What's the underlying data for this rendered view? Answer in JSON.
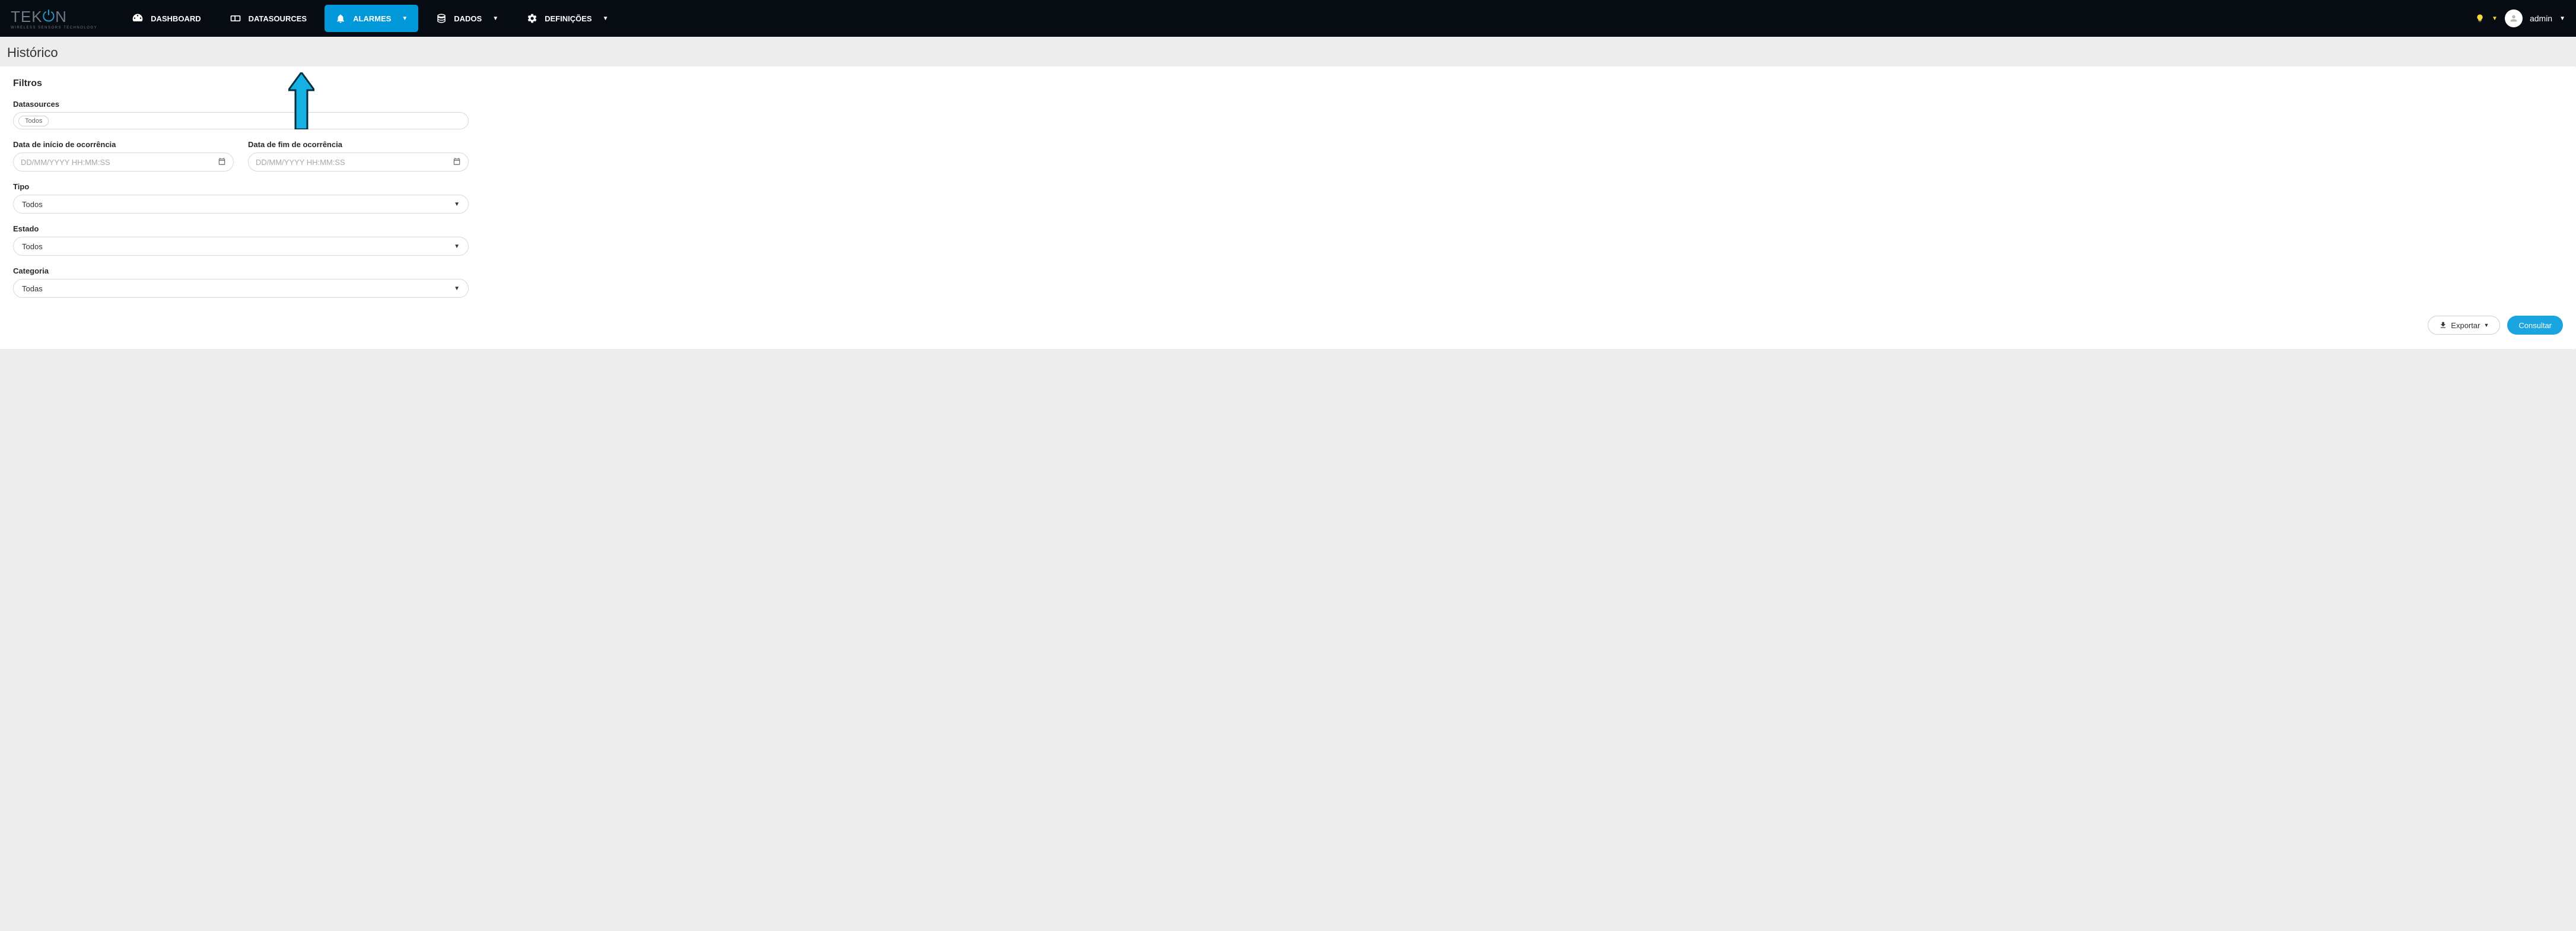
{
  "brand": {
    "name": "TEKON",
    "tagline": "WIRELESS SENSORS TECHNOLOGY"
  },
  "nav": {
    "dashboard": "DASHBOARD",
    "datasources": "DATASOURCES",
    "alarmes": "ALARMES",
    "dados": "DADOS",
    "definicoes": "DEFINIÇÕES"
  },
  "user": {
    "name": "admin"
  },
  "page": {
    "title": "Histórico",
    "filters_heading": "Filtros"
  },
  "filters": {
    "datasources_label": "Datasources",
    "datasources_tag": "Todos",
    "date_start_label": "Data de início de ocorrência",
    "date_end_label": "Data de fim de ocorrência",
    "date_placeholder": "DD/MM/YYYY HH:MM:SS",
    "tipo_label": "Tipo",
    "tipo_value": "Todos",
    "estado_label": "Estado",
    "estado_value": "Todos",
    "categoria_label": "Categoria",
    "categoria_value": "Todas"
  },
  "actions": {
    "export": "Exportar",
    "consultar": "Consultar"
  }
}
